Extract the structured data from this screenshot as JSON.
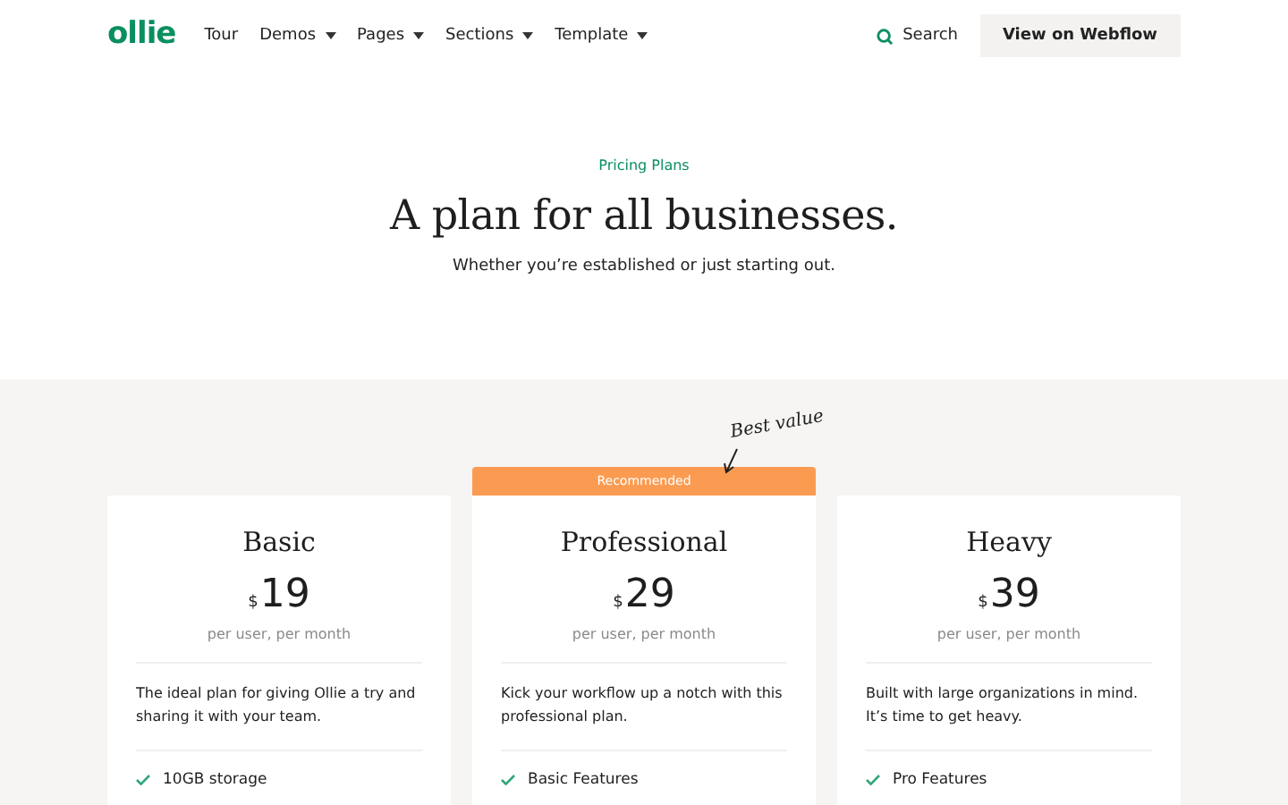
{
  "nav": {
    "logo": "ollie",
    "links": [
      {
        "label": "Tour",
        "dropdown": false
      },
      {
        "label": "Demos",
        "dropdown": true
      },
      {
        "label": "Pages",
        "dropdown": true
      },
      {
        "label": "Sections",
        "dropdown": true
      },
      {
        "label": "Template",
        "dropdown": true
      }
    ],
    "search": "Search",
    "cta": "View on Webflow"
  },
  "hero": {
    "eyebrow": "Pricing Plans",
    "title": "A plan for all businesses.",
    "subtitle": "Whether you’re established or just starting out."
  },
  "annotation": "Best value",
  "plans": [
    {
      "name": "Basic",
      "currency": "$",
      "price": "19",
      "period": "per user, per month",
      "description": "The ideal plan for giving Ollie a try and sharing it with your team.",
      "features": [
        "10GB storage"
      ]
    },
    {
      "name": "Professional",
      "ribbon": "Recommended",
      "currency": "$",
      "price": "29",
      "period": "per user, per month",
      "description": "Kick your workflow up a notch with this professional plan.",
      "features": [
        "Basic Features"
      ]
    },
    {
      "name": "Heavy",
      "currency": "$",
      "price": "39",
      "period": "per user, per month",
      "description": "Built with large organizations in mind. It’s time to get heavy.",
      "features": [
        "Pro Features"
      ]
    }
  ]
}
